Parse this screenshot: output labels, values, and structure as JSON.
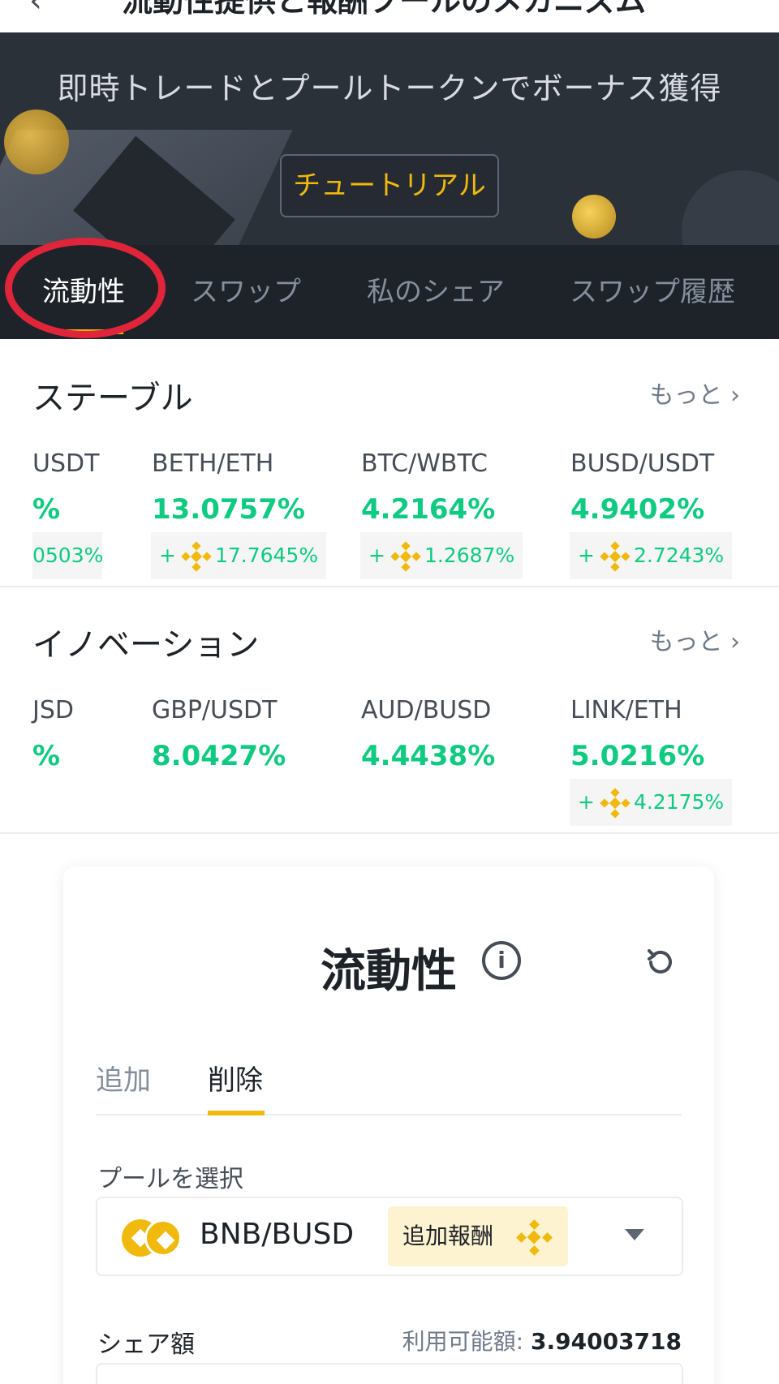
{
  "header": {
    "title": "流動性提供と報酬プールのメカニズム"
  },
  "hero": {
    "slogan": "即時トレードとプールトークンでボーナス獲得",
    "tutorial_button": "チュートリアル",
    "tabs": [
      "流動性",
      "スワップ",
      "私のシェア",
      "スワップ履歴"
    ]
  },
  "stable": {
    "title": "ステーブル",
    "more": "もっと",
    "pools": [
      {
        "pair": "USDT",
        "apy": "%",
        "bonus": "0503%"
      },
      {
        "pair": "BETH/ETH",
        "apy": "13.0757%",
        "bonus": "17.7645%"
      },
      {
        "pair": "BTC/WBTC",
        "apy": "4.2164%",
        "bonus": "1.2687%"
      },
      {
        "pair": "BUSD/USDT",
        "apy": "4.9402%",
        "bonus": "2.7243%"
      }
    ]
  },
  "innovation": {
    "title": "イノベーション",
    "more": "もっと",
    "pools": [
      {
        "pair": "JSD",
        "apy": "%"
      },
      {
        "pair": "GBP/USDT",
        "apy": "8.0427%"
      },
      {
        "pair": "AUD/BUSD",
        "apy": "4.4438%"
      },
      {
        "pair": "LINK/ETH",
        "apy": "5.0216%",
        "bonus": "4.2175%"
      }
    ]
  },
  "card": {
    "title": "流動性",
    "tabs": [
      "追加",
      "削除"
    ],
    "select_label": "プールを選択",
    "selected_pair": "BNB/BUSD",
    "reward_badge": "追加報酬",
    "share_label": "シェア額",
    "available_label": "利用可能額:",
    "available_value": "3.94003718"
  },
  "icons": {
    "back": "back-arrow-icon",
    "info": "info-icon",
    "refresh": "refresh-icon",
    "bnb": "bnb-logo-icon",
    "chevron": "chevron-right-icon",
    "caret": "caret-down-icon"
  },
  "colors": {
    "accent": "#f0b90b",
    "positive": "#0ecb81",
    "annotation": "#e0243a",
    "dark": "#1e2329"
  }
}
